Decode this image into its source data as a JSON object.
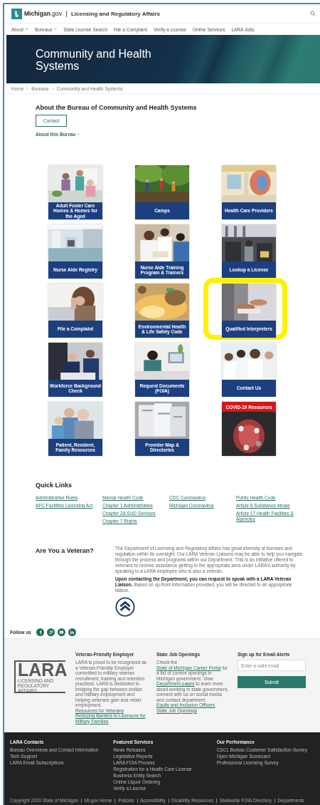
{
  "header": {
    "site": "**Michigan**.gov",
    "agency": "Licensing and Regulatory Affairs"
  },
  "nav": [
    {
      "label": "About",
      "has_menu": true
    },
    {
      "label": "Bureaus",
      "has_menu": true
    },
    {
      "label": "State License Search",
      "has_menu": false
    },
    {
      "label": "File a Complaint",
      "has_menu": false
    },
    {
      "label": "Verify a License",
      "has_menu": false
    },
    {
      "label": "Online Services",
      "has_menu": false
    },
    {
      "label": "LARA Jobs",
      "has_menu": false
    }
  ],
  "banner": {
    "title": "Community and Health Systems"
  },
  "breadcrumb": [
    "Home",
    "Bureaus",
    "Community and Health Systems"
  ],
  "about": {
    "heading": "About the Bureau of Community and Health Systems",
    "button": "Contact",
    "link": "About this Bureau"
  },
  "tiles": [
    {
      "label": "Adult Foster Care Homes & Homes for the Aged",
      "highlighted": false
    },
    {
      "label": "Camps",
      "highlighted": false
    },
    {
      "label": "Health Care Providers",
      "highlighted": false
    },
    {
      "label": "Nurse Aide Registry",
      "highlighted": false
    },
    {
      "label": "Nurse Aide Training Program & Trainers",
      "highlighted": false
    },
    {
      "label": "Lookup a License",
      "highlighted": false
    },
    {
      "label": "File a Complaint",
      "highlighted": false
    },
    {
      "label": "Environmental Health & Life Safety Code",
      "highlighted": false
    },
    {
      "label": "Qualified Interpreters",
      "highlighted": true
    },
    {
      "label": "Workforce Background Check",
      "highlighted": false
    },
    {
      "label": "Request Documents (FOIA)",
      "highlighted": false
    },
    {
      "label": "Contact Us",
      "highlighted": false
    },
    {
      "label": "Patient, Resident, Family Resources",
      "highlighted": false
    },
    {
      "label": "Provider Map & Directories",
      "highlighted": false
    }
  ],
  "alert_tile": {
    "label": "COVID-19 Resources"
  },
  "quick_links": {
    "heading": "Quick Links",
    "columns": [
      {
        "links": [
          "Administrative Rules",
          "AFC Facilities Licensing Act"
        ]
      },
      {
        "links": [
          "Mental Health Code",
          "Chapter 1 Administrative",
          "Chapter 2A SUD Services",
          "Chapter 7 Rights"
        ]
      },
      {
        "links": [
          "CDC Coronavirus",
          "Michigan Coronavirus"
        ]
      },
      {
        "links": [
          "Public Health Code",
          "Article 6 Substance Abuse",
          "Article 17 Health Facilities & Agencies"
        ]
      }
    ]
  },
  "veteran": {
    "heading": "Are You a Veteran?",
    "text": "The Department of Licensing and Regulatory Affairs has great diversity of licenses and regulation within its oversight. Our LARA Veteran Liaisons may be able to help you navigate through the process and programs within our Department. This is an initiative offered to veterans to receive assistance getting to the appropriate area under LARA's authority by speaking to a LARA employee who is also a veteran.",
    "note": "**Upon contacting the Department, you can request to speak with a LARA Veteran Liaison.** Based on up-front information provided, you will be directed to an appropriate liaison."
  },
  "follow": {
    "label": "Follow us"
  },
  "footer_band": {
    "logo": {
      "word": "LARA",
      "subtitle": "LICENSING AND REGULATORY AFFAIRS"
    },
    "employer": {
      "heading": "Veteran-Friendly Employer",
      "text": "LARA is proud to be recognized as a Veteran-Friendly Employer committed to military veteran recruitment, training and retention practices. LARA is dedicated to bridging the gap between civilian and military employment and helping veterans gain and retain employment.",
      "links": [
        "Resources for Veterans",
        "Reducing Barriers to Licensure for Military Families"
      ]
    },
    "jobs": {
      "heading": "State Job Openings",
      "segments": [
        {
          "text": "Check the ",
          "link": false
        },
        {
          "text": "State of Michigan Career Portal",
          "link": true
        },
        {
          "text": " for a list of current openings in Michigan government. View ",
          "link": false
        },
        {
          "text": "Department pages",
          "link": true
        },
        {
          "text": " to learn more about working in state government, connect with us on social media and contact department ",
          "link": false
        },
        {
          "text": "Equity and Inclusion Officers",
          "link": true
        },
        {
          "text": ".",
          "link": false
        }
      ],
      "link": "State Job Openings"
    },
    "alerts": {
      "heading": "Sign up for Email Alerts",
      "placeholder": "Enter a valid email",
      "button": "Submit"
    }
  },
  "footer": {
    "columns": [
      {
        "title": "LARA Contacts",
        "links": [
          "Bureau Overviews and Contact Information",
          "Tech Support",
          "LARA Email Subscriptions"
        ]
      },
      {
        "title": "Featured Services",
        "links": [
          "News Releases",
          "Legislative Reports",
          "LARA FOIA Process",
          "Registration for a Health Care License",
          "Business Entity Search",
          "Online Liquor Ordering",
          "Verify a License"
        ]
      },
      {
        "title": "Our Performance",
        "links": [
          "CSCL Bureau Customer Satisfaction Survey",
          "Open Michigan Scorecard",
          "Professional Licensing Survey"
        ]
      }
    ],
    "legal": [
      "Copyright 2020 State of Michigan",
      "MI.gov Home",
      "Policies",
      "Accessibility",
      "Disability Resources",
      "Statewide FOIA Directory",
      "Departments"
    ]
  }
}
